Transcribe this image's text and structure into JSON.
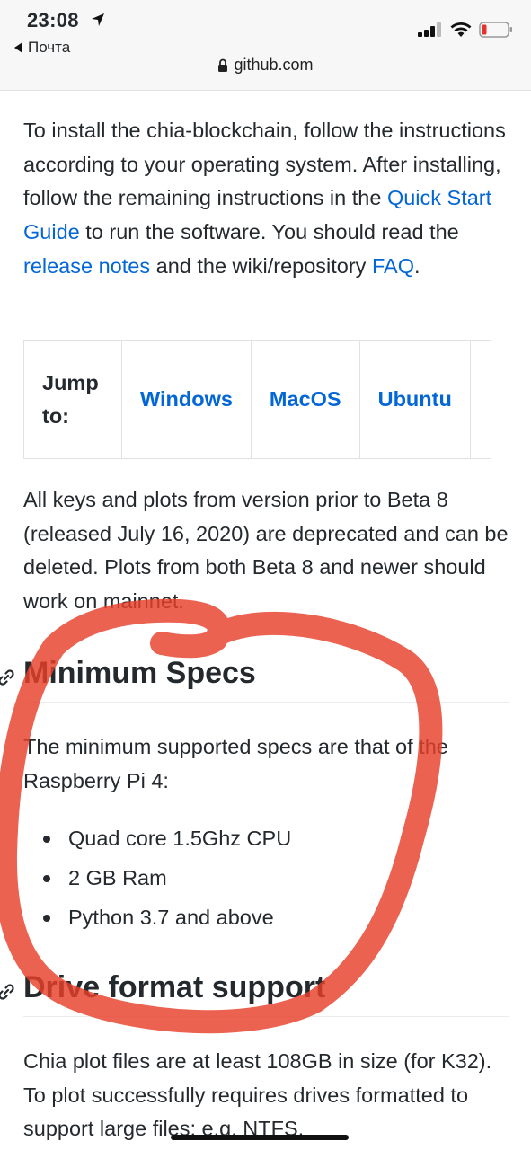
{
  "status_bar": {
    "time": "23:08",
    "back_label": "Почта",
    "url": "github.com"
  },
  "intro": {
    "text_1": "To install the chia-blockchain, follow the instructions according to your operating system. After installing, follow the remaining instructions in the ",
    "link_quick_start": "Quick Start Guide",
    "text_2": " to run the software. You should read the ",
    "link_release_notes": "release notes",
    "text_3": " and the wiki/repository ",
    "link_faq": "FAQ",
    "text_4": "."
  },
  "jump_table": {
    "label": "Jump to:",
    "links": [
      "Windows",
      "MacOS",
      "Ubuntu"
    ]
  },
  "deprecation_text": "All keys and plots from version prior to Beta 8 (released July 16, 2020) are deprecated and can be deleted. Plots from both Beta 8 and newer should work on mainnet.",
  "min_specs": {
    "heading": "Minimum Specs",
    "intro": "The minimum supported specs are that of the Raspberry Pi 4:",
    "items": [
      "Quad core 1.5Ghz CPU",
      "2 GB Ram",
      "Python 3.7 and above"
    ]
  },
  "drive_format": {
    "heading": "Drive format support",
    "text": "Chia plot files are at least 108GB in size (for K32). To plot successfully requires drives formatted to support large files; e.g. NTFS,"
  },
  "colors": {
    "link": "#0366d6",
    "text": "#24292e",
    "annotation": "#e8402a"
  }
}
